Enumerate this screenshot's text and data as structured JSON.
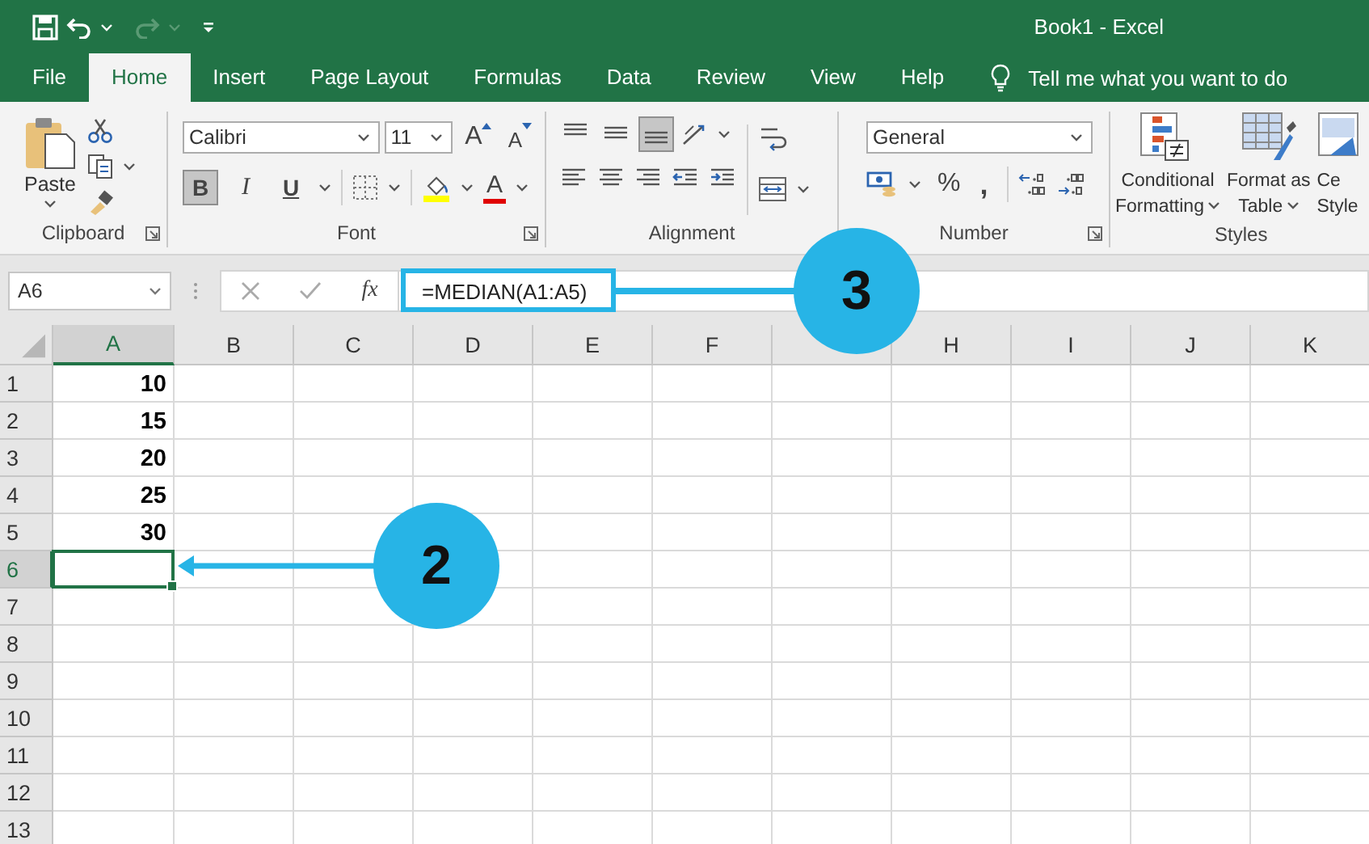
{
  "window": {
    "title": "Book1  -  Excel"
  },
  "tabs": [
    {
      "label": "File",
      "selected": false
    },
    {
      "label": "Home",
      "selected": true
    },
    {
      "label": "Insert",
      "selected": false
    },
    {
      "label": "Page Layout",
      "selected": false
    },
    {
      "label": "Formulas",
      "selected": false
    },
    {
      "label": "Data",
      "selected": false
    },
    {
      "label": "Review",
      "selected": false
    },
    {
      "label": "View",
      "selected": false
    },
    {
      "label": "Help",
      "selected": false
    }
  ],
  "tell_me": {
    "placeholder": "Tell me what you want to do"
  },
  "ribbon": {
    "clipboard": {
      "label": "Clipboard",
      "paste": "Paste"
    },
    "font": {
      "label": "Font",
      "font_name": "Calibri",
      "font_size": "11",
      "grow": "A",
      "shrink": "A",
      "color_glyph": "A",
      "styles": [
        {
          "kind": "bold",
          "glyph": "B",
          "selected": true
        },
        {
          "kind": "italic",
          "glyph": "I",
          "selected": false
        },
        {
          "kind": "underline",
          "glyph": "U",
          "selected": false
        }
      ]
    },
    "alignment": {
      "label": "Alignment",
      "vertical": [
        {
          "kind": "top",
          "selected": false
        },
        {
          "kind": "middle",
          "selected": false
        },
        {
          "kind": "bottom",
          "selected": true
        }
      ]
    },
    "number": {
      "label": "Number",
      "format": "General",
      "percent": "%",
      "comma": ","
    },
    "styles": {
      "label": "Styles",
      "buttons": [
        {
          "kind": "conditional",
          "lines": [
            "Conditional",
            "Formatting"
          ]
        },
        {
          "kind": "table",
          "lines": [
            "Format as",
            "Table"
          ]
        },
        {
          "kind": "cell",
          "lines": [
            "Ce",
            "Style"
          ]
        }
      ]
    }
  },
  "formula_bar": {
    "name_box": "A6",
    "fx": "fx",
    "formula": "=MEDIAN(A1:A5)"
  },
  "sheet": {
    "columns": [
      {
        "label": "A",
        "selected": true
      },
      {
        "label": "B",
        "selected": false
      },
      {
        "label": "C",
        "selected": false
      },
      {
        "label": "D",
        "selected": false
      },
      {
        "label": "E",
        "selected": false
      },
      {
        "label": "F",
        "selected": false
      },
      {
        "selected": false
      },
      {
        "label": "H",
        "selected": false
      },
      {
        "label": "I",
        "selected": false
      },
      {
        "label": "J",
        "selected": false
      },
      {
        "label": "K",
        "selected": false
      }
    ],
    "rows": [
      {
        "label": "1",
        "value": "10",
        "selected": false
      },
      {
        "label": "2",
        "value": "15",
        "selected": false
      },
      {
        "label": "3",
        "value": "20",
        "selected": false
      },
      {
        "label": "4",
        "value": "25",
        "selected": false
      },
      {
        "label": "5",
        "value": "30",
        "selected": false
      },
      {
        "label": "6",
        "selected": true
      },
      {
        "label": "7",
        "selected": false
      },
      {
        "label": "8",
        "selected": false
      },
      {
        "label": "9",
        "selected": false
      },
      {
        "label": "10",
        "selected": false
      },
      {
        "label": "11",
        "selected": false
      },
      {
        "label": "12",
        "selected": false
      },
      {
        "label": "13",
        "selected": false
      }
    ]
  },
  "callouts": [
    {
      "kind": "formula",
      "number": "3"
    },
    {
      "kind": "cell",
      "number": "2"
    }
  ]
}
